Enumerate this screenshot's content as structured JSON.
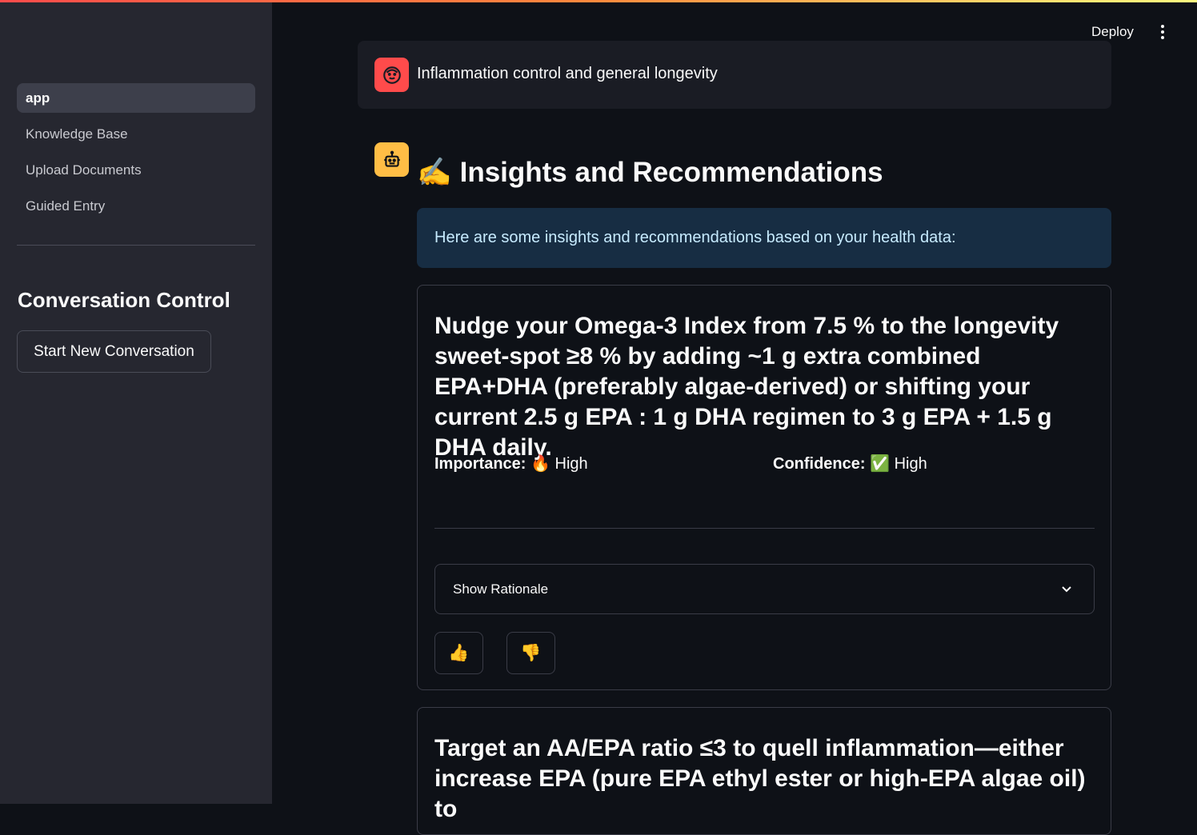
{
  "sidebar": {
    "nav": [
      "app",
      "Knowledge Base",
      "Upload Documents",
      "Guided Entry"
    ],
    "heading": "Conversation Control",
    "new_conversation": "Start New Conversation"
  },
  "header": {
    "deploy": "Deploy"
  },
  "user_message": {
    "text": "Inflammation control and general longevity",
    "avatar_icon": "user-face-icon"
  },
  "assistant": {
    "avatar_icon": "robot-icon",
    "title_emoji": "✍️",
    "title": "Insights and Recommendations",
    "info": "Here are some insights and recommendations based on your health data:"
  },
  "recommendations": [
    {
      "title": "Nudge your Omega-3 Index from 7.5 % to the longevity sweet-spot ≥8 % by adding ~1 g extra combined EPA+DHA (preferably algae-derived) or shifting your current 2.5 g EPA : 1 g DHA regimen to 3 g EPA + 1.5 g DHA daily.",
      "importance_label": "Importance:",
      "importance_emoji": "🔥",
      "importance": "High",
      "confidence_label": "Confidence:",
      "confidence_emoji": "✅",
      "confidence": "High",
      "expander": "Show Rationale",
      "thumbs_up": "👍",
      "thumbs_down": "👎"
    },
    {
      "title": "Target an AA/EPA ratio ≤3 to quell inflammation—either increase EPA (pure EPA ethyl ester or high-EPA algae oil) to"
    }
  ],
  "colors": {
    "accent": "#ff4b4b",
    "bot_avatar": "#ffbd45",
    "info_bg": "#172d43",
    "info_text": "#c7ebff"
  }
}
